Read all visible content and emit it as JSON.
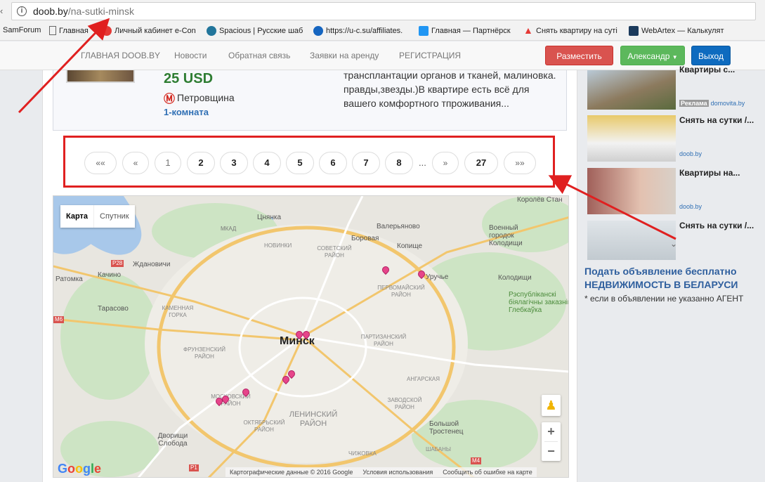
{
  "browser": {
    "url_host": "doob.by",
    "url_path": "/na-sutki-minsk",
    "bookmarks": [
      {
        "label": "SamForum",
        "icon": "none",
        "color": "#f2f2f2"
      },
      {
        "label": "Главная",
        "icon": "page-icon",
        "color": "#ffffff"
      },
      {
        "label": "Личный кабинет e-Con",
        "icon": "e-icon",
        "color": "#e53935"
      },
      {
        "label": "Spacious | Русские шаб",
        "icon": "wordpress-icon",
        "color": "#21759b"
      },
      {
        "label": "https://u-c.su/affiliates.",
        "icon": "u-icon",
        "color": "#1565c0"
      },
      {
        "label": "Главная — Партнёрск",
        "icon": "t-icon",
        "color": "#2196f3"
      },
      {
        "label": "Снять квартиру на суті",
        "icon": "arrow-up-icon",
        "color": "#e53935"
      },
      {
        "label": "WebArtex — Калькулят",
        "icon": "w-icon",
        "color": "#1b3a5c"
      }
    ]
  },
  "header": {
    "nav": [
      "ГЛАВНАЯ DOOB.BY",
      "Новости",
      "Обратная связь",
      "Заявки на аренду",
      "РЕГИСТРАЦИЯ"
    ],
    "post_button": "Разместить",
    "user_button": "Александр",
    "logout_button": "Выход"
  },
  "listing": {
    "price": "25 USD",
    "metro": "Петровщина",
    "rooms": "1-комната",
    "description": "трансплантации органов и тканей, малиновка. правды,звезды.)В квартире есть всё для вашего комфортного тпроживания..."
  },
  "pagination": {
    "first": "««",
    "prev": "«",
    "pages": [
      "1",
      "2",
      "3",
      "4",
      "5",
      "6",
      "7",
      "8"
    ],
    "current": "1",
    "ellipsis": "...",
    "next": "»",
    "last_page": "27",
    "last": "»»"
  },
  "map": {
    "type_map": "Карта",
    "type_satellite": "Спутник",
    "city": "Минск",
    "places": [
      "Цнянка",
      "Валерьяново",
      "Военный городок Колодищи",
      "Боровая",
      "Копище",
      "Ждановичи",
      "Качино",
      "Ратомка",
      "Тарасово",
      "Колодищи",
      "Большой Тростенец",
      "Дворищи Слобода",
      "Уручье",
      "Королёв Стан"
    ],
    "districts": [
      "НОВИНКИ",
      "СОВЕТСКИЙ РАЙОН",
      "ПЕРВОМАЙСКИЙ РАЙОН",
      "КАМЕННАЯ ГОРКА",
      "ПАРТИЗАНСКИЙ РАЙОН",
      "ФРУНЗЕНСКИЙ РАЙОН",
      "АНГАРСКАЯ",
      "МОСКОВСКИЙ РАЙОН",
      "ЛЕНИНСКИЙ РАЙОН",
      "ЗАВОДСКОЙ РАЙОН",
      "ОКТЯБРЬСКИЙ РАЙОН",
      "ШАБАНЫ",
      "ЧИЖОВКА"
    ],
    "reserve": "Рэспубліканскі біялагічны заказнік Глебкаўка",
    "road_labels": [
      "МКАД",
      "P28",
      "M6",
      "P1",
      "M4"
    ],
    "zoom_in": "+",
    "zoom_out": "−",
    "google": "Google",
    "footer": [
      "Картографические данные © 2016 Google",
      "Условия использования",
      "Сообщить об ошибке на карте"
    ]
  },
  "sidebar": {
    "ads": [
      {
        "title": "Квартиры с...",
        "source": "domovita.by",
        "tag": "Реклама"
      },
      {
        "title": "Снять на сутки /...",
        "source": "doob.by",
        "tag": ""
      },
      {
        "title": "Квартиры на...",
        "source": "doob.by",
        "tag": ""
      },
      {
        "title": "Снять на сутки /...",
        "source": "",
        "tag": ""
      }
    ],
    "promo_line1": "Подать объявление бесплатно",
    "promo_line2": "НЕДВИЖИМОСТЬ В БЕЛАРУСИ",
    "promo_note": "* если в объявлении не указанно АГЕНТ"
  }
}
